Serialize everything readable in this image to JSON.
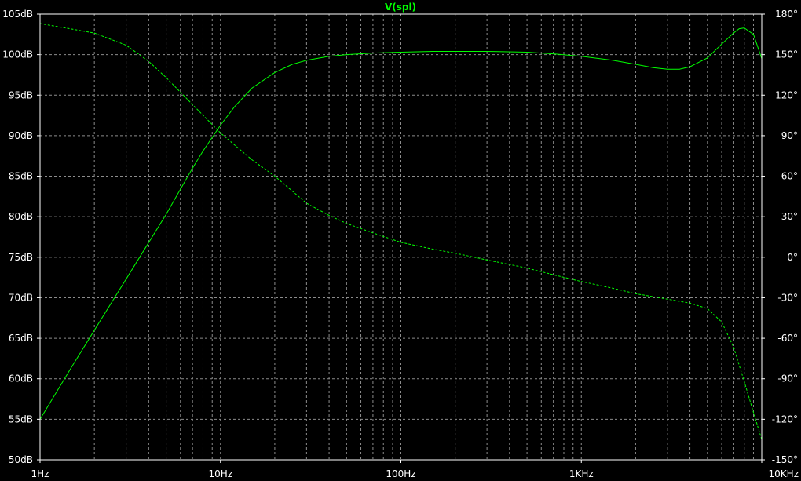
{
  "chart_data": {
    "type": "line",
    "title": "V(spl)",
    "xscale": "log",
    "xlim": [
      1,
      10000
    ],
    "ylim": [
      50,
      105
    ],
    "y2lim": [
      -150,
      180
    ],
    "x_ticks": [
      {
        "value": 1,
        "label": "1Hz"
      },
      {
        "value": 10,
        "label": "10Hz"
      },
      {
        "value": 100,
        "label": "100Hz"
      },
      {
        "value": 1000,
        "label": "1KHz"
      },
      {
        "value": 10000,
        "label": "10KHz"
      }
    ],
    "y_ticks": [
      {
        "value": 50,
        "label": "50dB"
      },
      {
        "value": 55,
        "label": "55dB"
      },
      {
        "value": 60,
        "label": "60dB"
      },
      {
        "value": 65,
        "label": "65dB"
      },
      {
        "value": 70,
        "label": "70dB"
      },
      {
        "value": 75,
        "label": "75dB"
      },
      {
        "value": 80,
        "label": "80dB"
      },
      {
        "value": 85,
        "label": "85dB"
      },
      {
        "value": 90,
        "label": "90dB"
      },
      {
        "value": 95,
        "label": "95dB"
      },
      {
        "value": 100,
        "label": "100dB"
      },
      {
        "value": 105,
        "label": "105dB"
      }
    ],
    "y2_ticks": [
      {
        "value": -150,
        "label": "-150°"
      },
      {
        "value": -120,
        "label": "-120°"
      },
      {
        "value": -90,
        "label": "-90°"
      },
      {
        "value": -60,
        "label": "-60°"
      },
      {
        "value": -30,
        "label": "-30°"
      },
      {
        "value": 0,
        "label": "0°"
      },
      {
        "value": 30,
        "label": "30°"
      },
      {
        "value": 60,
        "label": "60°"
      },
      {
        "value": 90,
        "label": "90°"
      },
      {
        "value": 120,
        "label": "120°"
      },
      {
        "value": 150,
        "label": "150°"
      },
      {
        "value": 180,
        "label": "180°"
      }
    ],
    "grid": true,
    "series": [
      {
        "axis": "left",
        "style": "solid",
        "x": [
          1,
          1.5,
          2,
          3,
          4,
          5,
          6,
          7,
          8,
          10,
          12,
          15,
          20,
          25,
          30,
          40,
          50,
          70,
          100,
          150,
          200,
          300,
          500,
          700,
          1000,
          1500,
          2000,
          2500,
          3000,
          3500,
          4000,
          5000,
          6000,
          7000,
          7500,
          8000,
          9000,
          10000
        ],
        "y": [
          55,
          61.5,
          66,
          72.3,
          76.8,
          80.3,
          83.4,
          86.0,
          88.1,
          91.3,
          93.6,
          95.9,
          97.8,
          98.8,
          99.3,
          99.8,
          100.0,
          100.2,
          100.3,
          100.4,
          100.4,
          100.4,
          100.3,
          100.1,
          99.8,
          99.3,
          98.8,
          98.4,
          98.2,
          98.2,
          98.5,
          99.6,
          101.3,
          102.7,
          103.2,
          103.3,
          102.5,
          99.5
        ]
      },
      {
        "axis": "right",
        "style": "dashed",
        "x": [
          1,
          2,
          3,
          4,
          5,
          7,
          10,
          15,
          20,
          30,
          40,
          50,
          70,
          100,
          150,
          200,
          300,
          500,
          700,
          1000,
          1500,
          2000,
          3000,
          4000,
          5000,
          6000,
          7000,
          8000,
          9000,
          10000
        ],
        "y": [
          173,
          166,
          157,
          145,
          133,
          113,
          92,
          72,
          60,
          40,
          31,
          25,
          18,
          11,
          6,
          3,
          -2,
          -8,
          -13,
          -18,
          -23,
          -27,
          -31,
          -34,
          -38,
          -48,
          -67,
          -92,
          -115,
          -135
        ]
      }
    ],
    "colors": {
      "background": "#000000",
      "trace": "#00ff00",
      "axis": "#ffffff",
      "grid": "#8c8c8c",
      "labels": "#ffffff",
      "title": "#00ff00"
    }
  }
}
